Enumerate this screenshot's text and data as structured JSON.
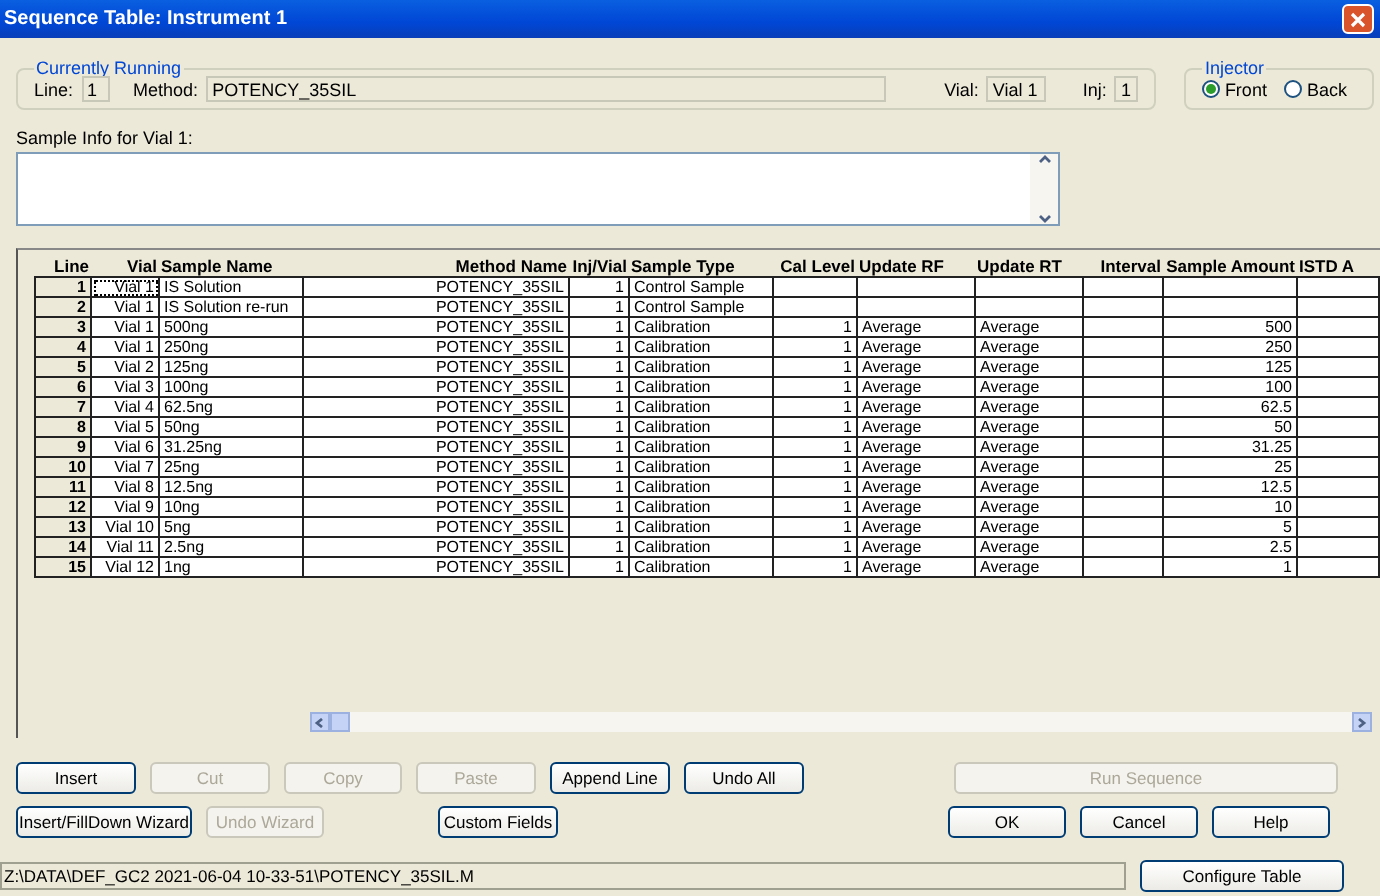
{
  "window": {
    "title": "Sequence Table: Instrument 1"
  },
  "currently_running": {
    "title": "Currently Running",
    "line_label": "Line:",
    "line": "1",
    "method_label": "Method:",
    "method": "POTENCY_35SIL",
    "vial_label": "Vial:",
    "vial": "Vial 1",
    "inj_label": "Inj:",
    "inj": "1"
  },
  "injector": {
    "title": "Injector",
    "options": [
      {
        "label": "Front",
        "selected": true
      },
      {
        "label": "Back",
        "selected": false
      }
    ]
  },
  "sample_info": {
    "label": "Sample Info for Vial 1:"
  },
  "table": {
    "columns": [
      {
        "label": "Line"
      },
      {
        "label": "Vial"
      },
      {
        "label": "Sample Name"
      },
      {
        "label": "Method Name"
      },
      {
        "label": "Inj/Vial"
      },
      {
        "label": "Sample Type"
      },
      {
        "label": "Cal Level"
      },
      {
        "label": "Update RF"
      },
      {
        "label": "Update RT"
      },
      {
        "label": "Interval"
      },
      {
        "label": "Sample Amount"
      },
      {
        "label": "ISTD A"
      }
    ],
    "rows": [
      {
        "line": "1",
        "vial": "Vial 1",
        "sample_name": "IS Solution",
        "method_name": "POTENCY_35SIL",
        "inj_vial": "1",
        "sample_type": "Control Sample",
        "focused": true
      },
      {
        "line": "2",
        "vial": "Vial 1",
        "sample_name": "IS Solution re-run",
        "method_name": "POTENCY_35SIL",
        "inj_vial": "1",
        "sample_type": "Control Sample",
        "focused": false
      },
      {
        "line": "3",
        "vial": "Vial 1",
        "sample_name": "500ng",
        "method_name": "POTENCY_35SIL",
        "inj_vial": "1",
        "sample_type": "Calibration",
        "cal_level": "1",
        "update_rf": "Average",
        "update_rt": "Average",
        "sample_amount": "500",
        "focused": false
      },
      {
        "line": "4",
        "vial": "Vial 1",
        "sample_name": "250ng",
        "method_name": "POTENCY_35SIL",
        "inj_vial": "1",
        "sample_type": "Calibration",
        "cal_level": "1",
        "update_rf": "Average",
        "update_rt": "Average",
        "sample_amount": "250",
        "focused": false
      },
      {
        "line": "5",
        "vial": "Vial 2",
        "sample_name": "125ng",
        "method_name": "POTENCY_35SIL",
        "inj_vial": "1",
        "sample_type": "Calibration",
        "cal_level": "1",
        "update_rf": "Average",
        "update_rt": "Average",
        "sample_amount": "125",
        "focused": false
      },
      {
        "line": "6",
        "vial": "Vial 3",
        "sample_name": "100ng",
        "method_name": "POTENCY_35SIL",
        "inj_vial": "1",
        "sample_type": "Calibration",
        "cal_level": "1",
        "update_rf": "Average",
        "update_rt": "Average",
        "sample_amount": "100",
        "focused": false
      },
      {
        "line": "7",
        "vial": "Vial 4",
        "sample_name": "62.5ng",
        "method_name": "POTENCY_35SIL",
        "inj_vial": "1",
        "sample_type": "Calibration",
        "cal_level": "1",
        "update_rf": "Average",
        "update_rt": "Average",
        "sample_amount": "62.5",
        "focused": false
      },
      {
        "line": "8",
        "vial": "Vial 5",
        "sample_name": "50ng",
        "method_name": "POTENCY_35SIL",
        "inj_vial": "1",
        "sample_type": "Calibration",
        "cal_level": "1",
        "update_rf": "Average",
        "update_rt": "Average",
        "sample_amount": "50",
        "focused": false
      },
      {
        "line": "9",
        "vial": "Vial 6",
        "sample_name": "31.25ng",
        "method_name": "POTENCY_35SIL",
        "inj_vial": "1",
        "sample_type": "Calibration",
        "cal_level": "1",
        "update_rf": "Average",
        "update_rt": "Average",
        "sample_amount": "31.25",
        "focused": false
      },
      {
        "line": "10",
        "vial": "Vial 7",
        "sample_name": "25ng",
        "method_name": "POTENCY_35SIL",
        "inj_vial": "1",
        "sample_type": "Calibration",
        "cal_level": "1",
        "update_rf": "Average",
        "update_rt": "Average",
        "sample_amount": "25",
        "focused": false
      },
      {
        "line": "11",
        "vial": "Vial 8",
        "sample_name": "12.5ng",
        "method_name": "POTENCY_35SIL",
        "inj_vial": "1",
        "sample_type": "Calibration",
        "cal_level": "1",
        "update_rf": "Average",
        "update_rt": "Average",
        "sample_amount": "12.5",
        "focused": false
      },
      {
        "line": "12",
        "vial": "Vial 9",
        "sample_name": "10ng",
        "method_name": "POTENCY_35SIL",
        "inj_vial": "1",
        "sample_type": "Calibration",
        "cal_level": "1",
        "update_rf": "Average",
        "update_rt": "Average",
        "sample_amount": "10",
        "focused": false
      },
      {
        "line": "13",
        "vial": "Vial 10",
        "sample_name": "5ng",
        "method_name": "POTENCY_35SIL",
        "inj_vial": "1",
        "sample_type": "Calibration",
        "cal_level": "1",
        "update_rf": "Average",
        "update_rt": "Average",
        "sample_amount": "5",
        "focused": false
      },
      {
        "line": "14",
        "vial": "Vial 11",
        "sample_name": "2.5ng",
        "method_name": "POTENCY_35SIL",
        "inj_vial": "1",
        "sample_type": "Calibration",
        "cal_level": "1",
        "update_rf": "Average",
        "update_rt": "Average",
        "sample_amount": "2.5",
        "focused": false
      },
      {
        "line": "15",
        "vial": "Vial 12",
        "sample_name": "1ng",
        "method_name": "POTENCY_35SIL",
        "inj_vial": "1",
        "sample_type": "Calibration",
        "cal_level": "1",
        "update_rf": "Average",
        "update_rt": "Average",
        "sample_amount": "1",
        "focused": false
      }
    ]
  },
  "buttons_row_1": [
    {
      "label": "Insert",
      "disabled": false
    },
    {
      "label": "Cut",
      "disabled": true
    },
    {
      "label": "Copy",
      "disabled": true
    },
    {
      "label": "Paste",
      "disabled": true
    },
    {
      "label": "Append Line",
      "disabled": false
    },
    {
      "label": "Undo All",
      "disabled": false
    }
  ],
  "run_button": {
    "label": "Run Sequence",
    "disabled": true
  },
  "buttons_row_2": [
    {
      "label": "Insert/FillDown Wizard",
      "disabled": false
    },
    {
      "label": "Undo Wizard",
      "disabled": true
    },
    {
      "label": "Custom Fields",
      "disabled": false
    }
  ],
  "dialog_buttons": [
    {
      "label": "OK",
      "disabled": false
    },
    {
      "label": "Cancel",
      "disabled": false
    },
    {
      "label": "Help",
      "disabled": false
    }
  ],
  "status_bar": {
    "path": "Z:\\DATA\\DEF_GC2 2021-06-04 10-33-51\\POTENCY_35SIL.M",
    "button": "Configure Table"
  }
}
